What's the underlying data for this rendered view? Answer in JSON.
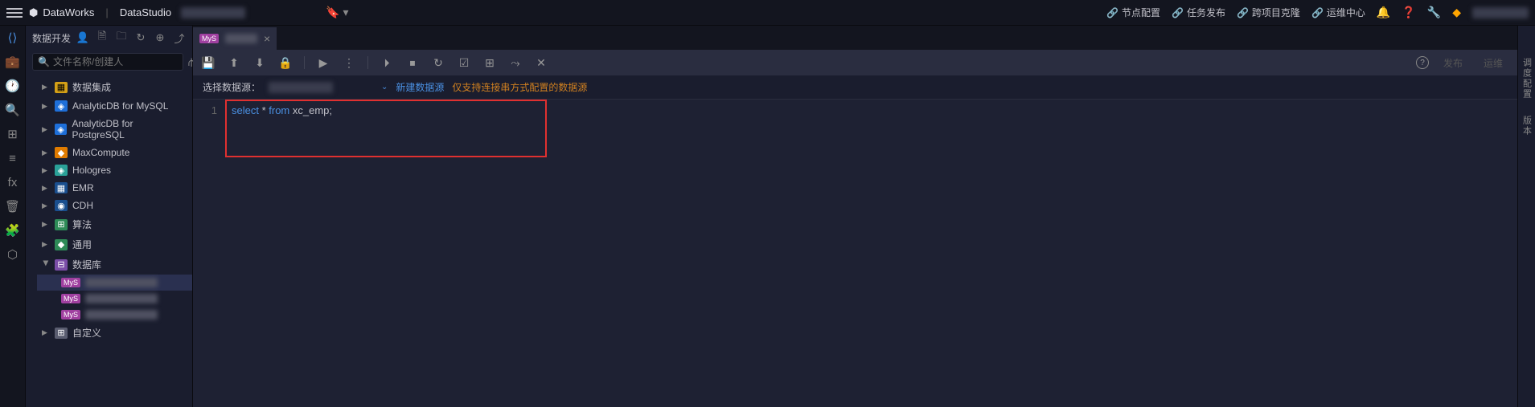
{
  "header": {
    "brand": "DataWorks",
    "product": "DataStudio",
    "links": [
      {
        "label": "节点配置"
      },
      {
        "label": "任务发布"
      },
      {
        "label": "跨项目克隆"
      },
      {
        "label": "运维中心"
      }
    ]
  },
  "sidebar": {
    "title": "数据开发",
    "search_placeholder": "文件名称/创建人",
    "tree": [
      {
        "label": "数据集成",
        "icon": "yellow",
        "expanded": false
      },
      {
        "label": "AnalyticDB for MySQL",
        "icon": "blue",
        "expanded": false
      },
      {
        "label": "AnalyticDB for PostgreSQL",
        "icon": "blue",
        "expanded": false
      },
      {
        "label": "MaxCompute",
        "icon": "orange",
        "expanded": false
      },
      {
        "label": "Hologres",
        "icon": "teal",
        "expanded": false
      },
      {
        "label": "EMR",
        "icon": "navy",
        "expanded": false
      },
      {
        "label": "CDH",
        "icon": "navy",
        "expanded": false
      },
      {
        "label": "算法",
        "icon": "green",
        "expanded": false
      },
      {
        "label": "通用",
        "icon": "green",
        "expanded": false
      },
      {
        "label": "数据库",
        "icon": "purple",
        "expanded": true
      }
    ],
    "db_children_count": 3,
    "leaf_badge": "MyS",
    "custom_label": "自定义"
  },
  "tab": {
    "badge": "MyS",
    "close": "×"
  },
  "datasource": {
    "label": "选择数据源：",
    "new_link": "新建数据源",
    "hint": "仅支持连接串方式配置的数据源"
  },
  "toolbar_right": {
    "publish": "发布",
    "ops": "运维"
  },
  "editor": {
    "line_num": "1",
    "code_kw1": "select",
    "code_op": " * ",
    "code_kw2": "from",
    "code_id": " xc_emp;"
  },
  "right_rail": {
    "label1": "调度配置",
    "label2": "版本"
  }
}
